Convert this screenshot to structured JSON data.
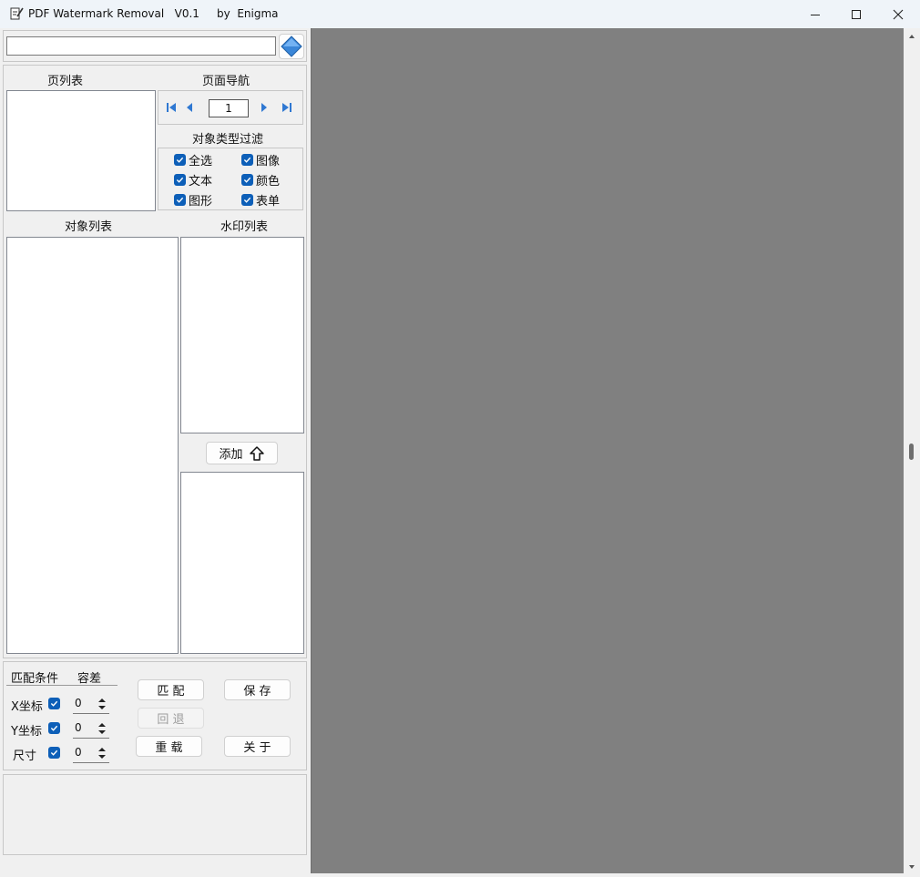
{
  "window": {
    "title": "PDF Watermark Removal   V0.1",
    "author": "by  Enigma",
    "icons": {
      "app": "document-pen-icon",
      "minimize": "minimize-icon",
      "maximize": "maximize-icon",
      "close": "close-icon"
    }
  },
  "toolbar": {
    "path_value": "",
    "open_icon": "blue-diamond-icon"
  },
  "pages": {
    "label": "页列表",
    "items": []
  },
  "nav": {
    "label": "页面导航",
    "page_value": "1",
    "icons": [
      "first-page-icon",
      "prev-page-icon",
      "next-page-icon",
      "last-page-icon"
    ]
  },
  "filter": {
    "label": "对象类型过滤",
    "options": [
      {
        "label": "全选",
        "checked": true
      },
      {
        "label": "图像",
        "checked": true
      },
      {
        "label": "文本",
        "checked": true
      },
      {
        "label": "颜色",
        "checked": true
      },
      {
        "label": "图形",
        "checked": true
      },
      {
        "label": "表单",
        "checked": true
      }
    ]
  },
  "objects": {
    "label": "对象列表",
    "items": []
  },
  "watermarks": {
    "label": "水印列表",
    "items": []
  },
  "add_button": {
    "label": "添加",
    "icon": "arrow-up-icon"
  },
  "match": {
    "header_condition": "匹配条件",
    "header_tolerance": "容差",
    "rows": [
      {
        "label": "X坐标",
        "checked": true,
        "value": "0"
      },
      {
        "label": "Y坐标",
        "checked": true,
        "value": "0"
      },
      {
        "label": "尺寸",
        "checked": true,
        "value": "0"
      }
    ]
  },
  "buttons": {
    "match": "匹 配",
    "save": "保 存",
    "undo": "回 退",
    "reload": "重 载",
    "about": "关 于"
  },
  "status": {
    "text": ""
  },
  "colors": {
    "accent": "#0d5fb8",
    "preview_bg": "#808080",
    "window_bg": "#f0f0f0"
  }
}
